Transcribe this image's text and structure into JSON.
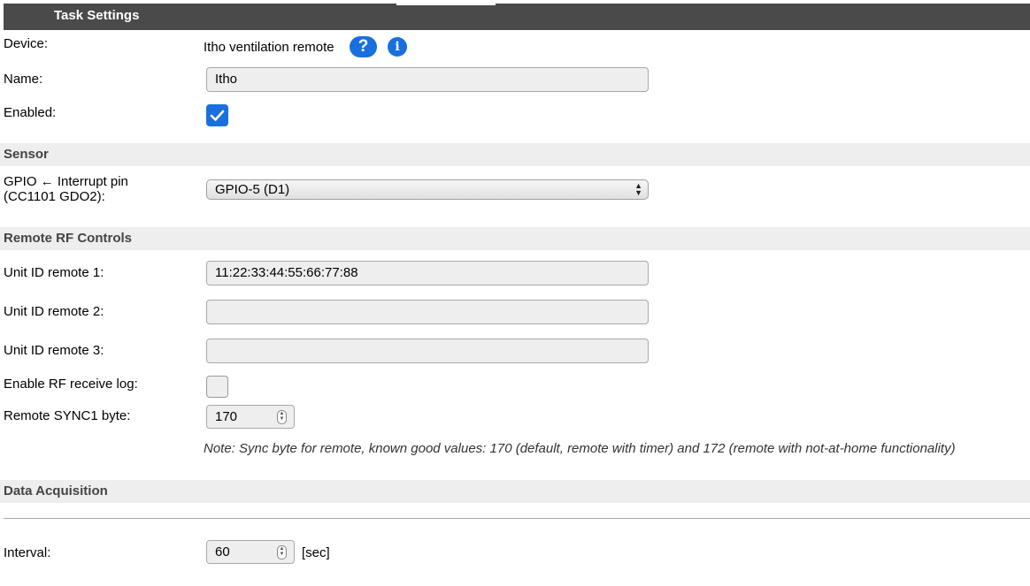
{
  "header": {
    "title": "Task Settings"
  },
  "device": {
    "label": "Device:",
    "value": "Itho ventilation remote",
    "help_icon": "question-icon",
    "info_icon": "info-icon"
  },
  "name": {
    "label": "Name:",
    "value": "Itho"
  },
  "enabled": {
    "label": "Enabled:",
    "checked": true
  },
  "sensor": {
    "title": "Sensor",
    "gpio_label_line1": "GPIO ← Interrupt pin",
    "gpio_label_line2": "(CC1101 GDO2):",
    "gpio_value": "GPIO-5 (D1)"
  },
  "remote": {
    "title": "Remote RF Controls",
    "unit1_label": "Unit ID remote 1:",
    "unit1_value": "11:22:33:44:55:66:77:88",
    "unit2_label": "Unit ID remote 2:",
    "unit2_value": "",
    "unit3_label": "Unit ID remote 3:",
    "unit3_value": "",
    "rf_log_label": "Enable RF receive log:",
    "rf_log_checked": false,
    "sync_label": "Remote SYNC1 byte:",
    "sync_value": "170",
    "note": "Note: Sync byte for remote, known good values: 170 (default, remote with timer) and 172 (remote with not-at-home functionality)"
  },
  "data_acquisition": {
    "title": "Data Acquisition",
    "interval_label": "Interval:",
    "interval_value": "60",
    "interval_unit": "[sec]"
  },
  "colors": {
    "header": "#4a4a4a",
    "section": "#eeeeee",
    "accent": "#1a6fde"
  }
}
